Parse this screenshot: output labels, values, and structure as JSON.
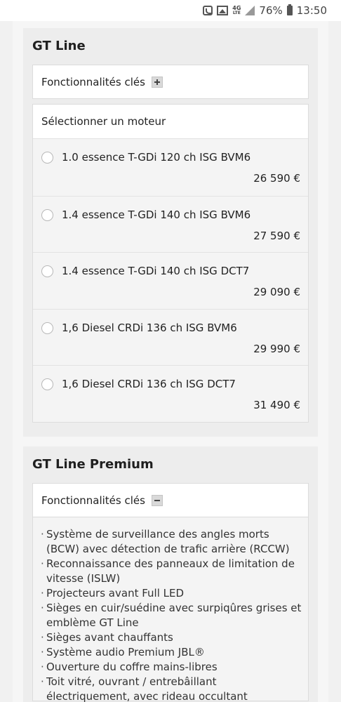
{
  "status_bar": {
    "network": "4G",
    "network_sub": "LTE",
    "battery": "76%",
    "time": "13:50"
  },
  "sections": [
    {
      "title": "GT Line",
      "features_label": "Fonctionnalités clés",
      "features_state": "collapsed",
      "engine_header": "Sélectionner un moteur",
      "engines": [
        {
          "name": "1.0 essence T-GDi 120 ch ISG BVM6",
          "price": "26 590 €"
        },
        {
          "name": "1.4 essence T-GDi 140 ch ISG BVM6",
          "price": "27 590 €"
        },
        {
          "name": "1.4 essence T-GDi 140 ch ISG DCT7",
          "price": "29 090 €"
        },
        {
          "name": "1,6 Diesel CRDi 136 ch ISG BVM6",
          "price": "29 990 €"
        },
        {
          "name": "1,6 Diesel CRDi 136 ch ISG DCT7",
          "price": "31 490 €"
        }
      ]
    },
    {
      "title": "GT Line Premium",
      "features_label": "Fonctionnalités clés",
      "features_state": "expanded",
      "features": [
        "Système de surveillance des angles morts (BCW) avec détection de trafic arrière (RCCW)",
        "Reconnaissance des panneaux de limitation de vitesse (ISLW)",
        "Projecteurs avant Full LED",
        "Sièges en cuir/suédine avec surpiqûres grises et emblème GT Line",
        "Sièges avant chauffants",
        "Système audio Premium JBL®",
        "Ouverture du coffre mains-libres",
        "Toit vitré, ouvrant / entrebâillant électriquement, avec rideau occultant électrique"
      ]
    }
  ]
}
